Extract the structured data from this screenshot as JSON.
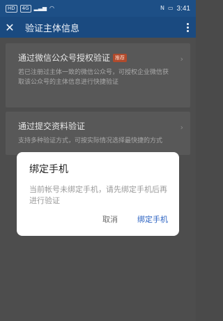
{
  "statusbar": {
    "hd_label": "HD",
    "net_label": "4G",
    "signal_bars": "▂▃▅",
    "wifi": "◠",
    "nfc": "N",
    "battery": "▭",
    "time": "3:41"
  },
  "titlebar": {
    "title": "验证主体信息",
    "close_glyph": "✕"
  },
  "cards": [
    {
      "title": "通过微信公众号授权验证",
      "badge": "推荐",
      "desc": "若已注册过主体一致的微信公众号，可授权企业微信获取该公众号的主体信息进行快捷验证"
    },
    {
      "title": "通过提交资料验证",
      "desc": "支持多种验证方式，可按实际情况选择最快捷的方式"
    }
  ],
  "dialog": {
    "title": "绑定手机",
    "message": "当前帐号未绑定手机，请先绑定手机后再进行验证",
    "cancel_label": "取消",
    "confirm_label": "绑定手机"
  }
}
